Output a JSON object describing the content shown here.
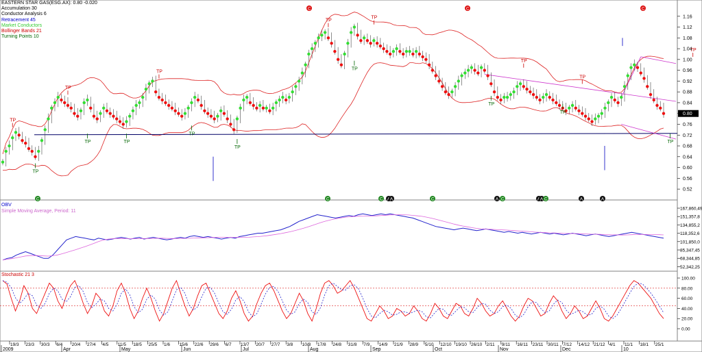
{
  "window": {
    "title": "EASTERN STAR GAS(ESG.AX): 0.80 -0.020"
  },
  "legend": [
    {
      "label": "Accumulation 30",
      "color": "#000000"
    },
    {
      "label": "Conductor Analysis 6",
      "color": "#000000"
    },
    {
      "label": "Retracement 45",
      "color": "#0000cc"
    },
    {
      "label": "Market Conductors",
      "color": "#33cc33"
    },
    {
      "label": "Bollinger Bands 21",
      "color": "#cc0000"
    },
    {
      "label": "Turning Points 10",
      "color": "#006600"
    }
  ],
  "panels": {
    "obv_label": "OBV",
    "sma_label": "Simple Moving Average, Period: 11",
    "stoch_label": "Stochastic 21 3"
  },
  "chart_data": [
    {
      "type": "line",
      "name": "price",
      "x_start": "2009-03-13",
      "ylim": [
        0.5,
        1.2
      ],
      "y_ticks": [
        "1.16",
        "1.12",
        "1.08",
        "1.04",
        "1.00",
        "0.96",
        "0.92",
        "0.88",
        "0.84",
        "0.80",
        "0.76",
        "0.72",
        "0.68",
        "0.64",
        "0.60",
        "0.56",
        "0.52"
      ],
      "last_price_label": "0.80",
      "support_line_level": 0.725,
      "price_close": [
        0.62,
        0.66,
        0.68,
        0.71,
        0.73,
        0.72,
        0.7,
        0.69,
        0.67,
        0.66,
        0.64,
        0.66,
        0.7,
        0.74,
        0.78,
        0.82,
        0.84,
        0.86,
        0.85,
        0.84,
        0.83,
        0.82,
        0.8,
        0.79,
        0.81,
        0.84,
        0.85,
        0.82,
        0.79,
        0.78,
        0.8,
        0.82,
        0.81,
        0.8,
        0.79,
        0.78,
        0.77,
        0.76,
        0.77,
        0.79,
        0.81,
        0.83,
        0.84,
        0.86,
        0.89,
        0.91,
        0.92,
        0.88,
        0.86,
        0.85,
        0.84,
        0.83,
        0.82,
        0.81,
        0.8,
        0.79,
        0.8,
        0.82,
        0.84,
        0.86,
        0.85,
        0.83,
        0.81,
        0.8,
        0.79,
        0.78,
        0.79,
        0.81,
        0.8,
        0.78,
        0.76,
        0.74,
        0.78,
        0.82,
        0.85,
        0.86,
        0.84,
        0.83,
        0.82,
        0.83,
        0.82,
        0.82,
        0.81,
        0.82,
        0.84,
        0.85,
        0.86,
        0.85,
        0.86,
        0.88,
        0.9,
        0.92,
        0.95,
        0.98,
        1.02,
        1.04,
        1.06,
        1.08,
        1.09,
        1.1,
        1.08,
        1.06,
        1.03,
        1.0,
        0.98,
        1.02,
        1.06,
        1.1,
        1.12,
        1.09,
        1.07,
        1.08,
        1.07,
        1.06,
        1.07,
        1.06,
        1.05,
        1.04,
        1.03,
        1.02,
        1.03,
        1.04,
        1.03,
        1.02,
        1.03,
        1.03,
        1.02,
        1.03,
        1.02,
        1.01,
        1.0,
        0.98,
        0.96,
        0.94,
        0.92,
        0.9,
        0.88,
        0.87,
        0.88,
        0.9,
        0.92,
        0.94,
        0.95,
        0.96,
        0.97,
        0.96,
        0.95,
        0.97,
        0.96,
        0.94,
        0.91,
        0.88,
        0.86,
        0.85,
        0.86,
        0.86,
        0.87,
        0.88,
        0.9,
        0.91,
        0.9,
        0.89,
        0.88,
        0.87,
        0.86,
        0.85,
        0.86,
        0.87,
        0.86,
        0.85,
        0.84,
        0.83,
        0.82,
        0.81,
        0.82,
        0.83,
        0.82,
        0.81,
        0.8,
        0.79,
        0.78,
        0.77,
        0.78,
        0.79,
        0.8,
        0.82,
        0.84,
        0.86,
        0.85,
        0.84,
        0.86,
        0.9,
        0.94,
        0.97,
        0.98,
        0.97,
        0.95,
        0.93,
        0.9,
        0.87,
        0.85,
        0.83,
        0.82,
        0.8
      ]
    },
    {
      "type": "line",
      "name": "obv",
      "y_ticks": [
        "167,860,49",
        "151,357,8",
        "134,855,2",
        "118,352,6",
        "101,850,0",
        "85,347,45",
        "68,344,85",
        "52,342,25"
      ],
      "values": [
        60,
        62,
        63,
        66,
        68,
        70,
        68,
        66,
        64,
        62,
        62,
        66,
        72,
        78,
        84,
        86,
        88,
        87,
        86,
        85,
        84,
        86,
        85,
        84,
        85,
        86,
        87,
        86,
        85,
        86,
        87,
        85,
        86,
        87,
        86,
        85,
        84,
        85,
        86,
        87,
        86,
        88,
        89,
        88,
        87,
        88,
        87,
        86,
        85,
        86,
        87,
        86,
        88,
        89,
        90,
        91,
        92,
        92,
        93,
        94,
        95,
        96,
        98,
        100,
        103,
        106,
        108,
        110,
        112,
        114,
        113,
        112,
        111,
        110,
        111,
        112,
        113,
        112,
        114,
        115,
        114,
        113,
        114,
        115,
        114,
        115,
        114,
        113,
        112,
        111,
        110,
        108,
        106,
        104,
        102,
        100,
        99,
        98,
        97,
        96,
        97,
        98,
        97,
        96,
        95,
        96,
        97,
        96,
        95,
        94,
        93,
        94,
        93,
        92,
        93,
        92,
        91,
        92,
        93,
        92,
        91,
        92,
        91,
        90,
        91,
        92,
        91,
        90,
        89,
        90,
        91,
        90,
        89,
        88,
        89,
        90,
        91,
        92,
        93,
        92,
        91,
        90,
        89,
        88,
        87,
        86
      ],
      "ylim": [
        50,
        125
      ]
    },
    {
      "type": "line",
      "name": "stochastic",
      "y_ticks": [
        "100.00",
        "80.00",
        "60.00",
        "40.00",
        "20.00",
        "0.00"
      ],
      "ylim": [
        0,
        100
      ],
      "levels": [
        80,
        45
      ],
      "values": [
        95,
        88,
        60,
        35,
        55,
        85,
        70,
        40,
        30,
        50,
        70,
        90,
        80,
        55,
        40,
        65,
        85,
        95,
        75,
        50,
        30,
        45,
        70,
        60,
        35,
        25,
        45,
        75,
        90,
        70,
        40,
        20,
        35,
        60,
        80,
        60,
        35,
        15,
        30,
        55,
        80,
        95,
        70,
        45,
        25,
        40,
        65,
        85,
        90,
        70,
        50,
        30,
        20,
        35,
        60,
        75,
        55,
        30,
        15,
        25,
        50,
        70,
        85,
        90,
        75,
        55,
        35,
        20,
        30,
        50,
        70,
        55,
        30,
        15,
        40,
        70,
        90,
        95,
        85,
        70,
        75,
        85,
        95,
        80,
        60,
        40,
        20,
        15,
        30,
        45,
        35,
        20,
        25,
        40,
        35,
        25,
        30,
        45,
        35,
        20,
        15,
        30,
        50,
        40,
        25,
        20,
        35,
        50,
        45,
        30,
        25,
        40,
        60,
        50,
        35,
        25,
        30,
        45,
        55,
        40,
        25,
        15,
        25,
        45,
        60,
        55,
        40,
        25,
        30,
        50,
        65,
        55,
        35,
        20,
        30,
        45,
        35,
        20,
        25,
        40,
        55,
        40,
        20,
        15,
        25,
        40,
        55,
        70,
        85,
        95,
        90,
        80,
        70,
        60,
        45,
        30,
        20
      ]
    },
    {
      "type": "table",
      "name": "x-axis",
      "date_labels": [
        "19/3",
        "23/3",
        "30/3",
        "6/4",
        "20/4",
        "27/4",
        "4/5",
        "11/5",
        "18/5",
        "25/5",
        "1/6",
        "15/6",
        "22/6",
        "29/6",
        "6/7",
        "13/7",
        "20/7",
        "27/7",
        "3/8",
        "10/8",
        "17/8",
        "24/8",
        "31/8",
        "7/9",
        "14/9",
        "21/9",
        "28/9",
        "5/10",
        "12/10",
        "19/10",
        "26/10",
        "2/11",
        "9/11",
        "16/11",
        "23/11",
        "30/11",
        "7/12",
        "14/12",
        "21/12",
        "4/1",
        "11/1",
        "18/1",
        "25/1"
      ],
      "month_labels": [
        "2009",
        "Apr",
        "May",
        "Jun",
        "Jul",
        "Aug",
        "Sep",
        "Oct",
        "Nov",
        "Dec",
        "10"
      ]
    }
  ],
  "markers": {
    "tp_label": "TP",
    "circle_c": "C",
    "circle_a": "A"
  }
}
